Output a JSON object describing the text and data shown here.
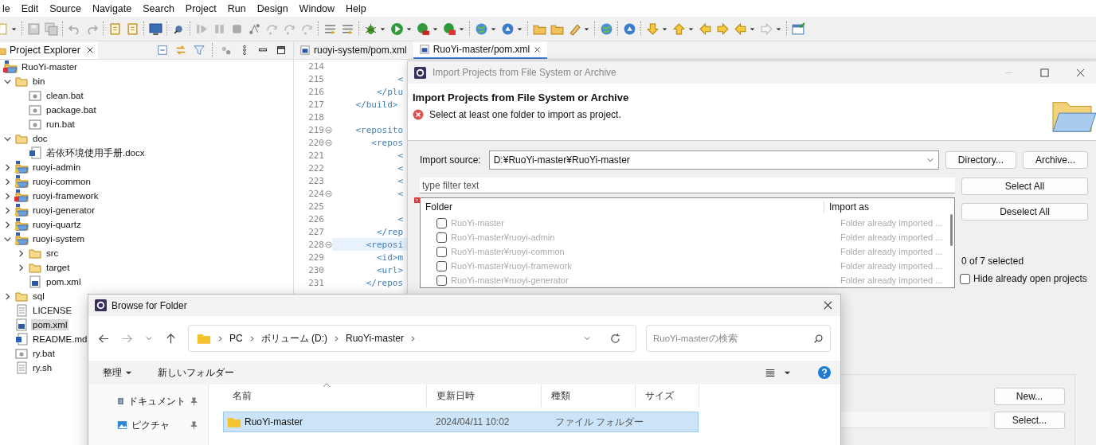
{
  "menu": [
    "le",
    "Edit",
    "Source",
    "Navigate",
    "Search",
    "Project",
    "Run",
    "Design",
    "Window",
    "Help"
  ],
  "explorer": {
    "title": "Project Explorer",
    "tree": [
      {
        "name": "RuoYi-master",
        "kind": "project",
        "error": true,
        "selected": false,
        "children": [
          {
            "name": "bin",
            "kind": "folder",
            "expanded": true,
            "selected": false,
            "children": [
              {
                "name": "clean.bat",
                "kind": "script",
                "selected": false
              },
              {
                "name": "package.bat",
                "kind": "script",
                "selected": false
              },
              {
                "name": "run.bat",
                "kind": "script",
                "selected": false
              }
            ]
          },
          {
            "name": "doc",
            "kind": "folder",
            "expanded": true,
            "selected": false,
            "children": [
              {
                "name": "若依环境使用手册.docx",
                "kind": "word",
                "selected": false
              }
            ]
          },
          {
            "name": "ruoyi-admin",
            "kind": "project",
            "error": false,
            "expanded": false,
            "selected": false
          },
          {
            "name": "ruoyi-common",
            "kind": "project",
            "error": false,
            "expanded": false,
            "selected": false
          },
          {
            "name": "ruoyi-framework",
            "kind": "project",
            "error": true,
            "expanded": false,
            "selected": false
          },
          {
            "name": "ruoyi-generator",
            "kind": "project",
            "error": false,
            "expanded": false,
            "selected": false
          },
          {
            "name": "ruoyi-quartz",
            "kind": "project",
            "error": false,
            "expanded": false,
            "selected": false
          },
          {
            "name": "ruoyi-system",
            "kind": "project",
            "error": false,
            "expanded": true,
            "selected": false,
            "children": [
              {
                "name": "src",
                "kind": "folder",
                "expanded": false,
                "selected": false
              },
              {
                "name": "target",
                "kind": "folder",
                "expanded": false,
                "selected": false
              },
              {
                "name": "pom.xml",
                "kind": "maven",
                "selected": false
              }
            ]
          },
          {
            "name": "sql",
            "kind": "folder",
            "expanded": false,
            "selected": false
          },
          {
            "name": "LICENSE",
            "kind": "text",
            "selected": false
          },
          {
            "name": "pom.xml",
            "kind": "maven",
            "selected": true
          },
          {
            "name": "README.md",
            "kind": "word",
            "selected": false
          },
          {
            "name": "ry.bat",
            "kind": "script",
            "selected": false
          },
          {
            "name": "ry.sh",
            "kind": "text",
            "selected": false
          }
        ]
      }
    ]
  },
  "editor": {
    "tabs": [
      {
        "label": "ruoyi-system/pom.xml",
        "selected": false
      },
      {
        "label": "RuoYi-master/pom.xml",
        "selected": true
      }
    ],
    "lines": [
      {
        "number": "214",
        "foldable": false,
        "current": false
      },
      {
        "number": "215",
        "code": "            <",
        "foldable": false,
        "current": false
      },
      {
        "number": "216",
        "code": "        </plu",
        "foldable": false,
        "current": false
      },
      {
        "number": "217",
        "code": "    </build>",
        "foldable": false,
        "current": false
      },
      {
        "number": "218",
        "foldable": false,
        "current": false
      },
      {
        "number": "219",
        "code": "    <reposito",
        "foldable": true,
        "current": false
      },
      {
        "number": "220",
        "code": "       <repos",
        "foldable": true,
        "current": false
      },
      {
        "number": "221",
        "code": "            <",
        "foldable": false,
        "current": false
      },
      {
        "number": "222",
        "code": "            <",
        "foldable": false,
        "current": false
      },
      {
        "number": "223",
        "code": "            <",
        "foldable": false,
        "current": false
      },
      {
        "number": "224",
        "code": "            <",
        "foldable": true,
        "current": false
      },
      {
        "number": "225",
        "foldable": false,
        "current": false
      },
      {
        "number": "226",
        "code": "            <",
        "foldable": false,
        "current": false
      },
      {
        "number": "227",
        "code": "        </rep",
        "foldable": false,
        "current": false
      },
      {
        "number": "228",
        "code": "      <reposi",
        "foldable": true,
        "current": true
      },
      {
        "number": "229",
        "code": "        <id>m",
        "foldable": false,
        "current": false
      },
      {
        "number": "230",
        "code": "        <url>",
        "foldable": false,
        "current": false
      },
      {
        "number": "231",
        "code": "      </repos",
        "foldable": false,
        "current": false
      }
    ]
  },
  "import_dialog": {
    "title": "Import Projects from File System or Archive",
    "heading": "Import Projects from File System or Archive",
    "message": "Select at least one folder to import as project.",
    "source_label": "Import source:",
    "source_value": "D:¥RuoYi-master¥RuoYi-master",
    "buttons": [
      "Directory...",
      "Archive..."
    ],
    "filter_placeholder": "type filter text",
    "list_buttons": [
      "Select All",
      "Deselect All"
    ],
    "columns": [
      "Folder",
      "Import as"
    ],
    "rows": [
      {
        "folder": "RuoYi-master",
        "import_as": "Folder already imported ...",
        "checked": false,
        "disabled": true
      },
      {
        "folder": "RuoYi-master¥ruoyi-admin",
        "import_as": "Folder already imported ...",
        "checked": false,
        "disabled": true
      },
      {
        "folder": "RuoYi-master¥ruoyi-common",
        "import_as": "Folder already imported ...",
        "checked": false,
        "disabled": true
      },
      {
        "folder": "RuoYi-master¥ruoyi-framework",
        "import_as": "Folder already imported ...",
        "checked": false,
        "disabled": true
      },
      {
        "folder": "RuoYi-master¥ruoyi-generator",
        "import_as": "Folder already imported ...",
        "checked": false,
        "disabled": true
      }
    ],
    "selection_count": "0 of 7 selected",
    "hide_open": {
      "label": "Hide already open projects",
      "checked": false
    },
    "working_set_buttons": [
      "New...",
      "Select..."
    ]
  },
  "browse_dialog": {
    "title": "Browse for Folder",
    "breadcrumb": [
      "PC",
      "ボリューム (D:)",
      "RuoYi-master"
    ],
    "search_placeholder": "RuoYi-masterの検索",
    "commands": [
      "整理",
      "新しいフォルダー"
    ],
    "nav": [
      {
        "label": "ドキュメント",
        "kind": "document"
      },
      {
        "label": "ピクチャ",
        "kind": "picture"
      }
    ],
    "columns": [
      "名前",
      "更新日時",
      "種類",
      "サイズ"
    ],
    "rows": [
      {
        "name": "RuoYi-master",
        "modified": "2024/04/11 10:02",
        "type": "ファイル フォルダー",
        "selected": true
      }
    ]
  }
}
